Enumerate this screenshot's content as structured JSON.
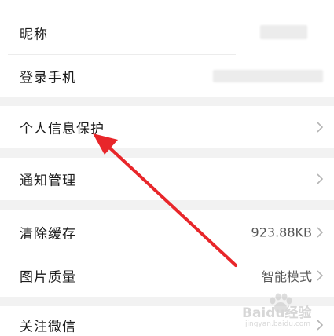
{
  "settings": {
    "items": [
      {
        "label": "昵称",
        "value": ""
      },
      {
        "label": "登录手机",
        "value": ""
      },
      {
        "label": "个人信息保护",
        "value": ""
      },
      {
        "label": "通知管理",
        "value": ""
      },
      {
        "label": "清除缓存",
        "value": "923.88KB"
      },
      {
        "label": "图片质量",
        "value": "智能模式"
      },
      {
        "label": "关注微信",
        "value": ""
      }
    ]
  },
  "annotation": {
    "arrow_color": "#e8262a"
  },
  "watermark": {
    "main": "Baidu经验",
    "sub": "jingyan.baidu.com"
  },
  "icons": {
    "chevron": "chevron-right-icon"
  }
}
